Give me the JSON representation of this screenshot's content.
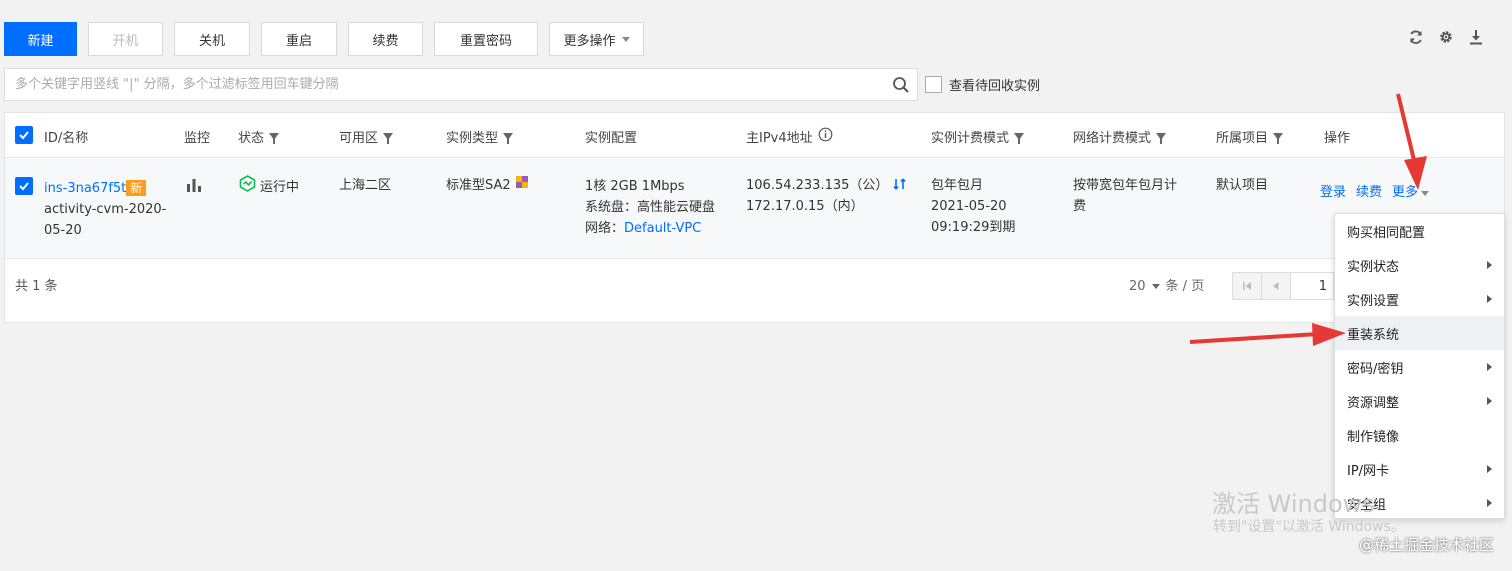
{
  "toolbar": {
    "buttons": [
      {
        "label": "新建"
      },
      {
        "label": "开机"
      },
      {
        "label": "关机"
      },
      {
        "label": "重启"
      },
      {
        "label": "续费"
      },
      {
        "label": "重置密码"
      },
      {
        "label": "更多操作"
      }
    ]
  },
  "search": {
    "placeholder": "多个关键字用竖线 \"|\" 分隔，多个过滤标签用回车键分隔",
    "recycle_label": "查看待回收实例"
  },
  "table": {
    "headers": {
      "id": "ID/名称",
      "monitor": "监控",
      "status": "状态",
      "zone": "可用区",
      "type": "实例类型",
      "config": "实例配置",
      "ip": "主IPv4地址",
      "billing": "实例计费模式",
      "net_billing": "网络计费模式",
      "project": "所属项目",
      "ops": "操作"
    },
    "row": {
      "id": "ins-3na67f5t",
      "new_tag": "新",
      "name_line1": "activity-cvm-2020-",
      "name_line2": "05-20",
      "status": "运行中",
      "zone": "上海二区",
      "type": "标准型SA2",
      "config_line1": "1核 2GB 1Mbps",
      "config_line2": "系统盘：高性能云硬盘",
      "config_net_label": "网络：",
      "config_net_link": "Default-VPC",
      "ip_public": "106.54.233.135（公）",
      "ip_private": "172.17.0.15（内）",
      "billing_line1": "包年包月",
      "billing_line2": "2021-05-20",
      "billing_line3": "09:19:29到期",
      "net_billing_line1": "按带宽包年包月计",
      "net_billing_line2": "费",
      "project": "默认项目",
      "op_login": "登录",
      "op_renew": "续费",
      "op_more": "更多"
    },
    "footer": {
      "total": "共 1 条",
      "page_size": "20",
      "page_size_unit": "条 / 页",
      "page_num": "1"
    }
  },
  "menu": {
    "items": [
      {
        "label": "购买相同配置",
        "has_submenu": false
      },
      {
        "label": "实例状态",
        "has_submenu": true
      },
      {
        "label": "实例设置",
        "has_submenu": true
      },
      {
        "label": "重装系统",
        "has_submenu": false
      },
      {
        "label": "密码/密钥",
        "has_submenu": true
      },
      {
        "label": "资源调整",
        "has_submenu": true
      },
      {
        "label": "制作镜像",
        "has_submenu": false
      },
      {
        "label": "IP/网卡",
        "has_submenu": true
      },
      {
        "label": "安全组",
        "has_submenu": true
      }
    ]
  },
  "overlay": {
    "watermark_line1": "激活 Windows",
    "watermark_line2": "转到\"设置\"以激活 Windows。",
    "credit": "@稀土掘金技术社区"
  },
  "colors": {
    "primary": "#006eff",
    "new_tag": "#ff9c19",
    "running": "#0abf5b",
    "annotation_arrow": "#e53935"
  }
}
